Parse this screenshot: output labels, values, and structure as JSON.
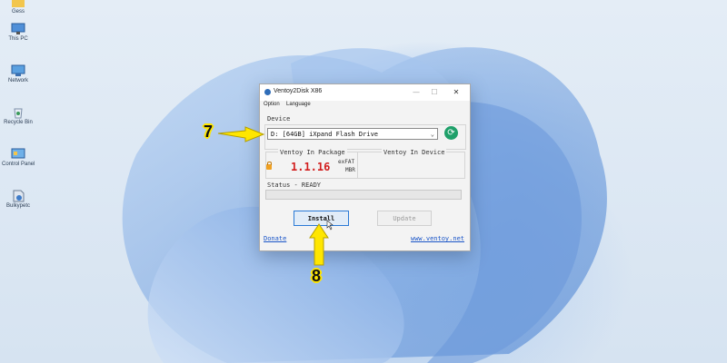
{
  "desktop": {
    "icons": [
      {
        "label": "Gess",
        "icon": "folder-icon"
      },
      {
        "label": "This PC",
        "icon": "computer-icon"
      },
      {
        "label": "Network",
        "icon": "network-icon"
      },
      {
        "label": "Recycle Bin",
        "icon": "recycle-bin-icon"
      },
      {
        "label": "Control Panel",
        "icon": "control-panel-icon"
      },
      {
        "label": "Bulkypetc",
        "icon": "app-icon"
      }
    ]
  },
  "window": {
    "title": "Ventoy2Disk X86",
    "controls": {
      "minimize": "—",
      "maximize": "☐",
      "close": "✕"
    },
    "menu": [
      "Option",
      "Language"
    ],
    "device": {
      "group_label": "Device",
      "selected": "D: [64GB] iXpand Flash Drive",
      "refresh_icon": "refresh-icon"
    },
    "package": {
      "label": "Ventoy In Package",
      "version": "1.1.16",
      "filesystem": "exFAT",
      "partition_style": "MBR"
    },
    "device_panel": {
      "label": "Ventoy In Device"
    },
    "status": {
      "text": "Status - READY",
      "progress": 0
    },
    "buttons": {
      "install": "Install",
      "update": "Update"
    },
    "links": {
      "donate": "Donate",
      "website": "www.ventoy.net"
    }
  },
  "annotations": {
    "step_device": "7",
    "step_install": "8",
    "color": "#ffe600"
  }
}
